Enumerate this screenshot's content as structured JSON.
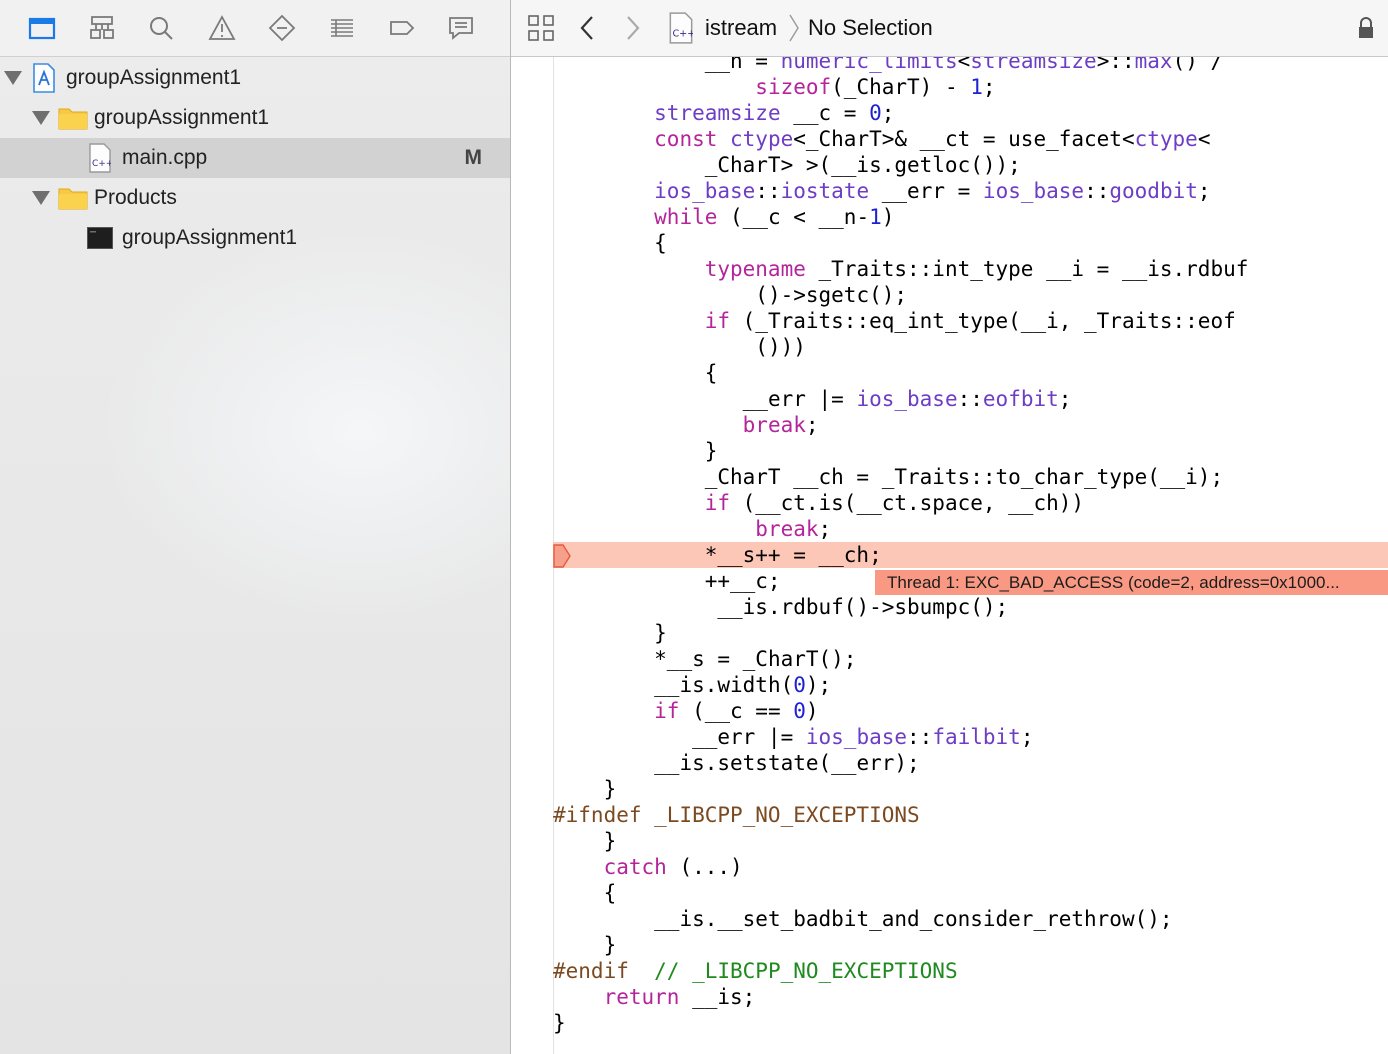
{
  "navigator": {
    "tools": [
      "folder-icon",
      "hierarchy-icon",
      "search-icon",
      "warning-icon",
      "test-diamond-icon",
      "list-icon",
      "tag-icon",
      "chat-icon"
    ],
    "tree": [
      {
        "label": "groupAssignment1",
        "kind": "project"
      },
      {
        "label": "groupAssignment1",
        "kind": "folder"
      },
      {
        "label": "main.cpp",
        "kind": "cpp-file",
        "badge": "M"
      },
      {
        "label": "Products",
        "kind": "folder"
      },
      {
        "label": "groupAssignment1",
        "kind": "executable"
      }
    ]
  },
  "jump_bar": {
    "file": "istream",
    "selection": "No Selection"
  },
  "colors": {
    "keyword": "#b4249b",
    "type": "#6d3dc5",
    "number": "#1d22d1",
    "preprocessor": "#7c4a21",
    "comment": "#1f8a1f",
    "error_line": "#fcc7b7",
    "error_banner": "#f99984",
    "accent": "#1a7ae8"
  },
  "code_lines": [
    {
      "indent": "            ",
      "parts": [
        [
          "__n = ",
          ""
        ],
        [
          "numeric_limits",
          "ty"
        ],
        [
          "<",
          ""
        ],
        [
          "streamsize",
          "ty"
        ],
        [
          ">::",
          ""
        ],
        [
          "max",
          "ty"
        ],
        [
          "() /",
          ""
        ]
      ]
    },
    {
      "indent": "                ",
      "parts": [
        [
          "sizeof",
          "kw"
        ],
        [
          "(_CharT) - ",
          ""
        ],
        [
          "1",
          "num"
        ],
        [
          ";",
          ""
        ]
      ]
    },
    {
      "indent": "        ",
      "parts": [
        [
          "streamsize",
          "ty"
        ],
        [
          " __c = ",
          ""
        ],
        [
          "0",
          "num"
        ],
        [
          ";",
          ""
        ]
      ]
    },
    {
      "indent": "        ",
      "parts": [
        [
          "const ",
          "kw"
        ],
        [
          "ctype",
          "ty"
        ],
        [
          "<_CharT>& __ct = use_facet<",
          ""
        ],
        [
          "ctype",
          "ty"
        ],
        [
          "<",
          ""
        ]
      ]
    },
    {
      "indent": "            ",
      "parts": [
        [
          "_CharT> >(__is.getloc());",
          ""
        ]
      ]
    },
    {
      "indent": "        ",
      "parts": [
        [
          "ios_base",
          "ty"
        ],
        [
          "::",
          ""
        ],
        [
          "iostate",
          "ty"
        ],
        [
          " __err = ",
          ""
        ],
        [
          "ios_base",
          "ty"
        ],
        [
          "::",
          ""
        ],
        [
          "goodbit",
          "ty"
        ],
        [
          ";",
          ""
        ]
      ]
    },
    {
      "indent": "        ",
      "parts": [
        [
          "while",
          "kw"
        ],
        [
          " (__c < __n-",
          ""
        ],
        [
          "1",
          "num"
        ],
        [
          ")",
          ""
        ]
      ]
    },
    {
      "indent": "        ",
      "parts": [
        [
          "{",
          ""
        ]
      ]
    },
    {
      "indent": "            ",
      "parts": [
        [
          "typename",
          "kw"
        ],
        [
          " _Traits::int_type __i = __is.rdbuf",
          ""
        ]
      ]
    },
    {
      "indent": "                ",
      "parts": [
        [
          "()->sgetc();",
          ""
        ]
      ]
    },
    {
      "indent": "            ",
      "parts": [
        [
          "if",
          "kw"
        ],
        [
          " (_Traits::eq_int_type(__i, _Traits::eof",
          ""
        ]
      ]
    },
    {
      "indent": "                ",
      "parts": [
        [
          "()))",
          ""
        ]
      ]
    },
    {
      "indent": "            ",
      "parts": [
        [
          "{",
          ""
        ]
      ]
    },
    {
      "indent": "               ",
      "parts": [
        [
          "__err |= ",
          ""
        ],
        [
          "ios_base",
          "ty"
        ],
        [
          "::",
          ""
        ],
        [
          "eofbit",
          "ty"
        ],
        [
          ";",
          ""
        ]
      ]
    },
    {
      "indent": "               ",
      "parts": [
        [
          "break",
          "kw"
        ],
        [
          ";",
          ""
        ]
      ]
    },
    {
      "indent": "            ",
      "parts": [
        [
          "}",
          ""
        ]
      ]
    },
    {
      "indent": "            ",
      "parts": [
        [
          "_CharT __ch = _Traits::to_char_type(__i);",
          ""
        ]
      ]
    },
    {
      "indent": "            ",
      "parts": [
        [
          "if",
          "kw"
        ],
        [
          " (__ct.is(__ct.space, __ch))",
          ""
        ]
      ]
    },
    {
      "indent": "                ",
      "parts": [
        [
          "break",
          "kw"
        ],
        [
          ";",
          ""
        ]
      ]
    },
    {
      "indent": "            ",
      "parts": [
        [
          "*__s++ = __ch;",
          ""
        ]
      ],
      "error": true
    },
    {
      "indent": "            ",
      "parts": [
        [
          "++__c;",
          ""
        ]
      ]
    },
    {
      "indent": "             ",
      "parts": [
        [
          "__is.rdbuf()->sbumpc();",
          ""
        ]
      ]
    },
    {
      "indent": "        ",
      "parts": [
        [
          "}",
          ""
        ]
      ]
    },
    {
      "indent": "        ",
      "parts": [
        [
          "*__s = _CharT();",
          ""
        ]
      ]
    },
    {
      "indent": "        ",
      "parts": [
        [
          "__is.width(",
          ""
        ],
        [
          "0",
          "num"
        ],
        [
          ");",
          ""
        ]
      ]
    },
    {
      "indent": "        ",
      "parts": [
        [
          "if",
          "kw"
        ],
        [
          " (__c == ",
          ""
        ],
        [
          "0",
          "num"
        ],
        [
          ")",
          ""
        ]
      ]
    },
    {
      "indent": "           ",
      "parts": [
        [
          "__err |= ",
          ""
        ],
        [
          "ios_base",
          "ty"
        ],
        [
          "::",
          ""
        ],
        [
          "failbit",
          "ty"
        ],
        [
          ";",
          ""
        ]
      ]
    },
    {
      "indent": "        ",
      "parts": [
        [
          "__is.setstate(__err);",
          ""
        ]
      ]
    },
    {
      "indent": "    ",
      "parts": [
        [
          "}",
          ""
        ]
      ]
    },
    {
      "indent": "",
      "parts": [
        [
          "#ifndef _LIBCPP_NO_EXCEPTIONS",
          "pp"
        ]
      ]
    },
    {
      "indent": "    ",
      "parts": [
        [
          "}",
          ""
        ]
      ]
    },
    {
      "indent": "    ",
      "parts": [
        [
          "catch",
          "kw"
        ],
        [
          " (...)",
          ""
        ]
      ]
    },
    {
      "indent": "    ",
      "parts": [
        [
          "{",
          ""
        ]
      ]
    },
    {
      "indent": "        ",
      "parts": [
        [
          "__is.__set_badbit_and_consider_rethrow();",
          ""
        ]
      ]
    },
    {
      "indent": "    ",
      "parts": [
        [
          "}",
          ""
        ]
      ]
    },
    {
      "indent": "",
      "parts": [
        [
          "#endif",
          "pp"
        ],
        [
          "  ",
          ""
        ],
        [
          "// _LIBCPP_NO_EXCEPTIONS",
          "cm"
        ]
      ]
    },
    {
      "indent": "    ",
      "parts": [
        [
          "return",
          "kw"
        ],
        [
          " __is;",
          ""
        ]
      ]
    },
    {
      "indent": "",
      "parts": [
        [
          "}",
          ""
        ]
      ]
    }
  ],
  "error": {
    "message": "Thread 1: EXC_BAD_ACCESS (code=2, address=0x1000..."
  }
}
